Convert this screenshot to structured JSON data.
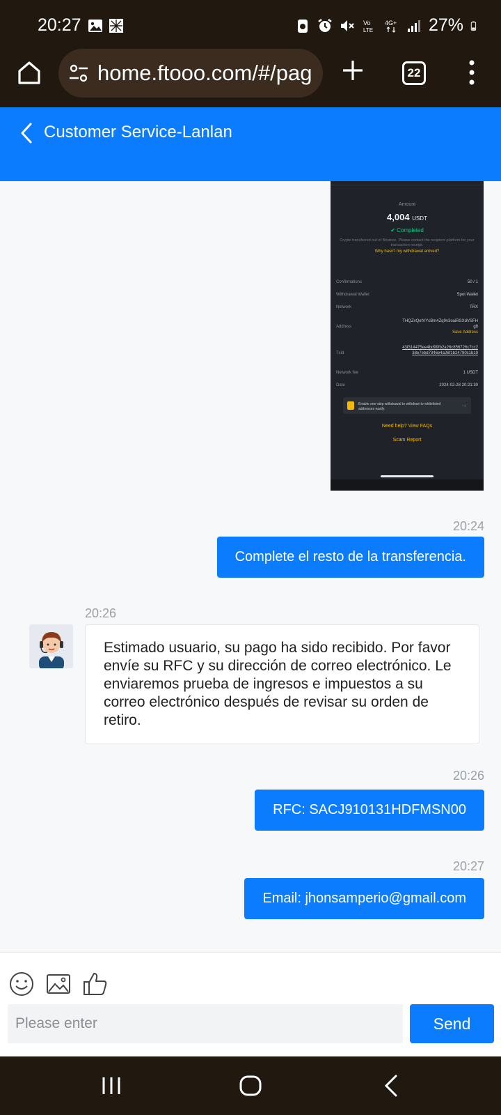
{
  "status_bar": {
    "time": "20:27",
    "battery": "27%",
    "icons": [
      "image-icon",
      "gallery-icon",
      "battery-saver-icon",
      "alarm-icon",
      "mute-icon",
      "volte-icon",
      "4g-icon",
      "signal-icon",
      "battery-icon"
    ]
  },
  "browser": {
    "url": "home.ftooo.com/#/pag",
    "tab_count": "22"
  },
  "header": {
    "title": "Customer Service-Lanlan"
  },
  "screenshot": {
    "amount_label": "Amount",
    "amount": "4,004",
    "amount_unit": "USDT",
    "status": "Completed",
    "note": "Crypto transferred out of Binance. Please contact the recipient platform for your transaction receipt.",
    "why_link": "Why hasn't my withdrawal arrived?",
    "rows": [
      {
        "label": "Confirmations",
        "value": "50 / 1"
      },
      {
        "label": "Withdrawal Wallet",
        "value": "Spot Wallet"
      },
      {
        "label": "Network",
        "value": "TRX"
      },
      {
        "label": "Address",
        "value": "THQZvQetVYcBm4Zq9v3oaiRSXdVSFHg8"
      },
      {
        "label": "Txid",
        "value": "43f314475ee4bd99fb2a26c856726c7cc238e7ebd7346e4a26f1b24790c1b19"
      },
      {
        "label": "Network fee",
        "value": "1 USDT"
      },
      {
        "label": "Date",
        "value": "2024-02-28 20:21:30"
      }
    ],
    "save_address": "Save Address",
    "banner": "Enable one-step withdrawal to withdraw to whitelisted addresses easily.",
    "help_link": "Need help? View FAQs",
    "scam_link": "Scam Report"
  },
  "messages": [
    {
      "direction": "out",
      "time": "20:24",
      "text": "Complete el resto de la transferencia."
    },
    {
      "direction": "in",
      "time": "20:26",
      "text": "Estimado usuario, su pago ha sido recibido. Por favor envíe su RFC y su dirección de correo electrónico. Le enviaremos prueba de ingresos e impuestos a su correo electrónico después de revisar su orden de retiro."
    },
    {
      "direction": "out",
      "time": "20:26",
      "text": "RFC: SACJ910131HDFMSN00"
    },
    {
      "direction": "out",
      "time": "20:27",
      "text": "Email: jhonsamperio@gmail.com"
    }
  ],
  "composer": {
    "placeholder": "Please enter",
    "send_label": "Send"
  },
  "colors": {
    "brand_blue": "#0c7cff",
    "system_bar": "#21190f"
  }
}
